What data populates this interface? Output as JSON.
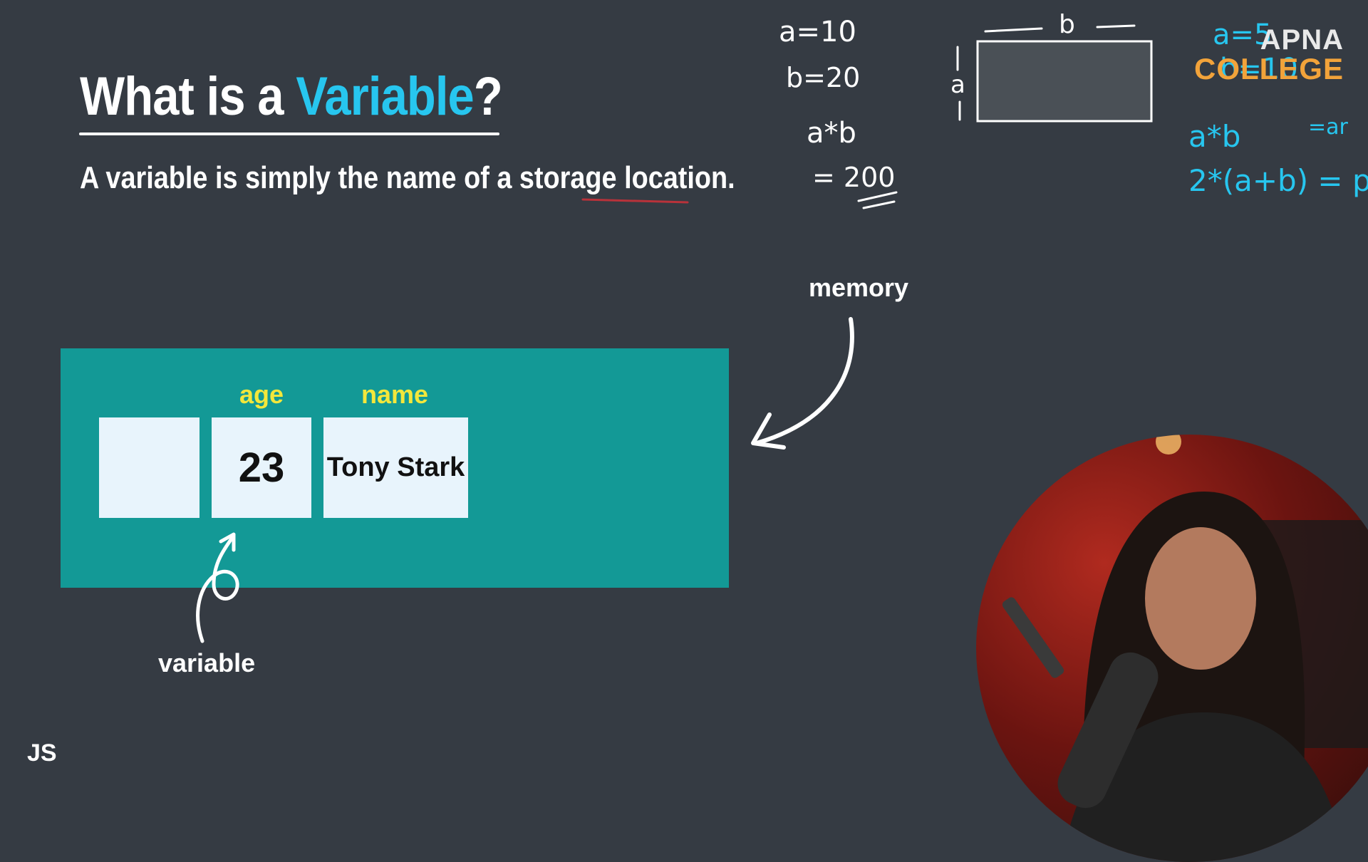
{
  "slide": {
    "title_prefix": "What is a ",
    "title_highlight": "Variable",
    "title_suffix": "?",
    "subtitle": "A variable is simply the name of a storage location."
  },
  "diagram": {
    "memory_label": "memory",
    "variable_label": "variable",
    "cells": [
      {
        "label": "",
        "value": ""
      },
      {
        "label": "age",
        "value": "23"
      },
      {
        "label": "name",
        "value": "Tony Stark"
      }
    ]
  },
  "handwriting": {
    "left_notes": [
      "a=10",
      "b=20",
      "a*b",
      "= 200"
    ],
    "rect_top_label": "b",
    "rect_side_label": "a",
    "right_notes": [
      "a=5",
      "b=10",
      "a*b",
      "=ar",
      "2*(a+b) = p"
    ]
  },
  "brand": {
    "line1": "APNA",
    "line2": "COLLEGE"
  },
  "footer": {
    "badge": "JS"
  },
  "colors": {
    "background": "#353b43",
    "highlight": "#27c6ef",
    "panel": "#139996",
    "cell": "#e8f4fc",
    "cell_label": "#f3e73b",
    "ink_white": "#ffffff",
    "ink_blue": "#27c6ef",
    "brand_orange": "#f2a33a"
  }
}
